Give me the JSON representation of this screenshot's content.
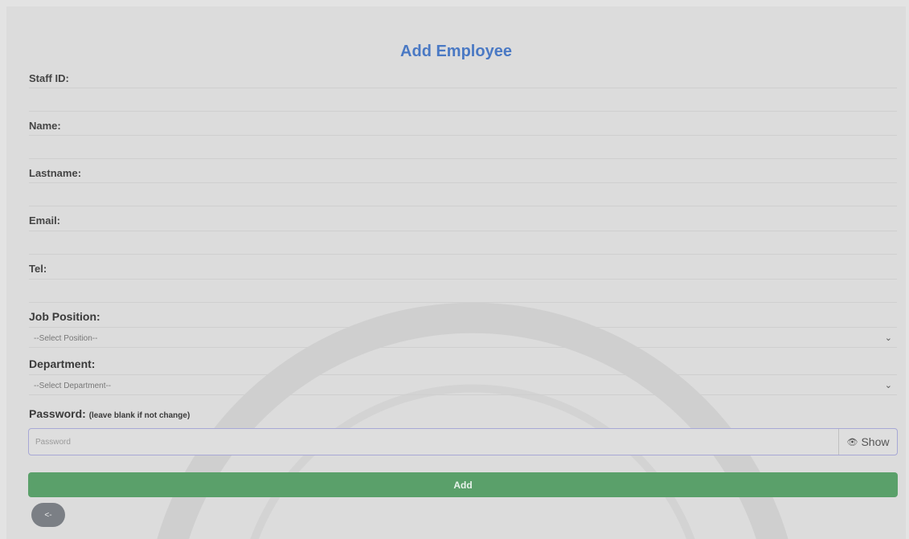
{
  "form": {
    "title": "Add Employee",
    "staff_id": {
      "label": "Staff ID:",
      "value": ""
    },
    "name": {
      "label": "Name:",
      "value": ""
    },
    "lastname": {
      "label": "Lastname:",
      "value": ""
    },
    "email": {
      "label": "Email:",
      "value": ""
    },
    "tel": {
      "label": "Tel:",
      "value": ""
    },
    "job_position": {
      "label": "Job Position:",
      "selected": "--Select Position--"
    },
    "department": {
      "label": "Department:",
      "selected": "--Select Department--"
    },
    "password": {
      "label": "Password:",
      "hint": "(leave blank if not change)",
      "placeholder": "Password",
      "show_label": "Show"
    },
    "add_label": "Add",
    "back_label": "<-"
  },
  "colors": {
    "title": "#4a79c4",
    "add_button": "#5aa06a",
    "back_button": "#7b7f85",
    "background": "#dcdcdc"
  },
  "icons": {
    "show": "eye-icon",
    "select_arrow": "chevron-down-icon"
  }
}
